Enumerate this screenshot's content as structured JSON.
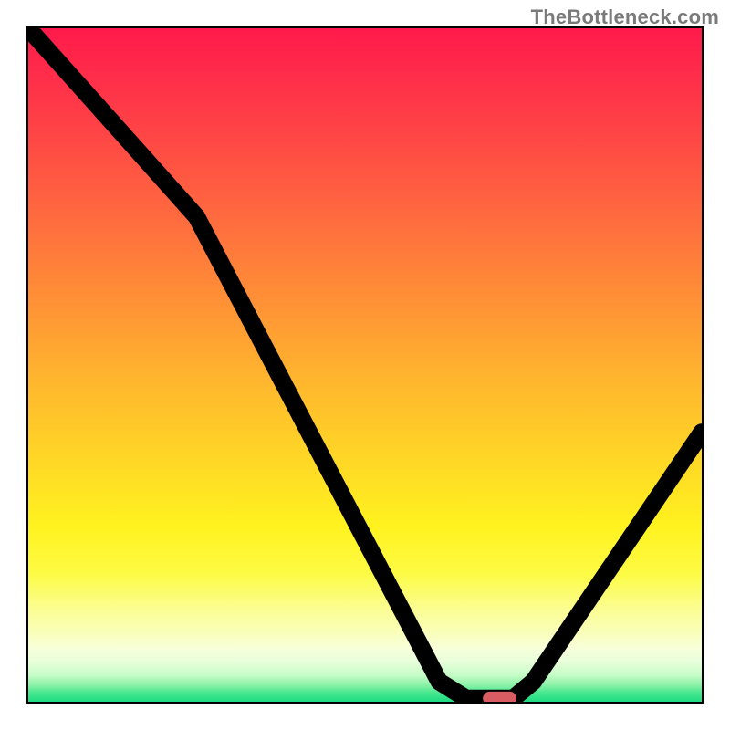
{
  "watermark": "TheBottleneck.com",
  "chart_data": {
    "type": "line",
    "title": "",
    "xlabel": "",
    "ylabel": "",
    "xlim": [
      0,
      100
    ],
    "ylim": [
      0,
      100
    ],
    "series": [
      {
        "name": "curve",
        "points": [
          {
            "x": 0,
            "y": 100
          },
          {
            "x": 25,
            "y": 72
          },
          {
            "x": 61,
            "y": 3
          },
          {
            "x": 65,
            "y": 0.5
          },
          {
            "x": 72,
            "y": 0.5
          },
          {
            "x": 75,
            "y": 3
          },
          {
            "x": 100,
            "y": 40
          }
        ]
      }
    ],
    "marker": {
      "x": 70,
      "y": 0.5,
      "width": 5,
      "height": 2
    },
    "gradient": {
      "top": "#ff1a4b",
      "mid_high": "#ff8f36",
      "mid": "#ffd726",
      "mid_low": "#fff21f",
      "low": "#1fdc82"
    }
  }
}
